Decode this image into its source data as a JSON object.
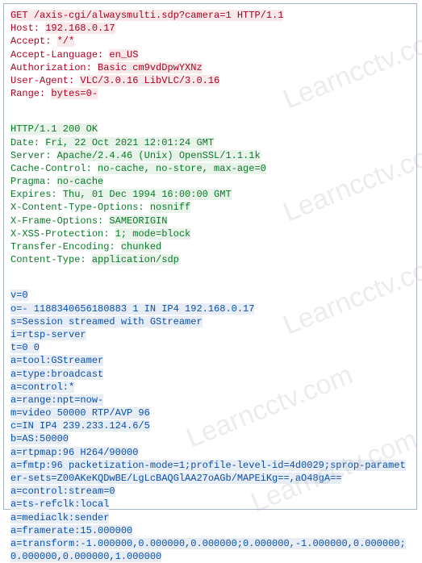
{
  "watermark": "Learncctv.com",
  "request": {
    "line1_a": "GET ",
    "line1_b": "/axis-cgi/alwaysmulti.sdp?camera=1",
    "line1_c": " HTTP/1.1",
    "host_key": "Host: ",
    "host_val": "192.168.0.17",
    "accept_key": "Accept: ",
    "accept_val": "*/*",
    "acceptlang_key": "Accept-Language: ",
    "acceptlang_val": "en_US",
    "auth_key": "Authorization: ",
    "auth_val": "Basic cm9vdDpwYXNz",
    "ua_key": "User-Agent: ",
    "ua_val": "VLC/3.0.16 LibVLC/3.0.16",
    "range_key": "Range: ",
    "range_val": "bytes=0-"
  },
  "response": {
    "status": "HTTP/1.1 200 OK",
    "date_key": "Date: ",
    "date_val": "Fri, 22 Oct 2021 12:01:24 GMT",
    "server_key": "Server: ",
    "server_val": "Apache/2.4.46 (Unix) OpenSSL/1.1.1k",
    "cache_key": "Cache-Control: ",
    "cache_val": "no-cache, no-store, max-age=0",
    "pragma_key": "Pragma: ",
    "pragma_val": "no-cache",
    "expires_key": "Expires: ",
    "expires_val": "Thu, 01 Dec 1994 16:00:00 GMT",
    "xcto_key": "X-Content-Type-Options: ",
    "xcto_val": "nosniff",
    "xfo_key": "X-Frame-Options: ",
    "xfo_val": "SAMEORIGIN",
    "xss_key": "X-XSS-Protection: ",
    "xss_val": "1; mode=block",
    "te_key": "Transfer-Encoding: ",
    "te_val": "chunked",
    "ct_key": "Content-Type: ",
    "ct_val": "application/sdp"
  },
  "body": {
    "l1": "v=0",
    "l2": "o=- 1188340656180883 1 IN IP4 192.168.0.17",
    "l3": "s=Session streamed with GStreamer",
    "l4": "i=rtsp-server",
    "l5": "t=0 0",
    "l6": "a=tool:GStreamer",
    "l7": "a=type:broadcast",
    "l8": "a=control:*",
    "l9": "a=range:npt=now-",
    "l10": "m=video 50000 RTP/AVP 96",
    "l11": "c=IN IP4 239.233.124.6/5",
    "l12": "b=AS:50000",
    "l13": "a=rtpmap:96 H264/90000",
    "l14": "a=fmtp:96 packetization-mode=1;profile-level-id=4d0029;sprop-parameter-sets=Z00AKeKQDwBE/LgLcBAQGlAA27oAGb/MAPEiKg==,aO48gA==",
    "l15": "a=control:stream=0",
    "l16": "a=ts-refclk:local",
    "l17": "a=mediaclk:sender",
    "l18": "a=framerate:15.000000",
    "l19": "a=transform:-1.000000,0.000000,0.000000;0.000000,-1.000000,0.000000;0.000000,0.000000,1.000000"
  }
}
